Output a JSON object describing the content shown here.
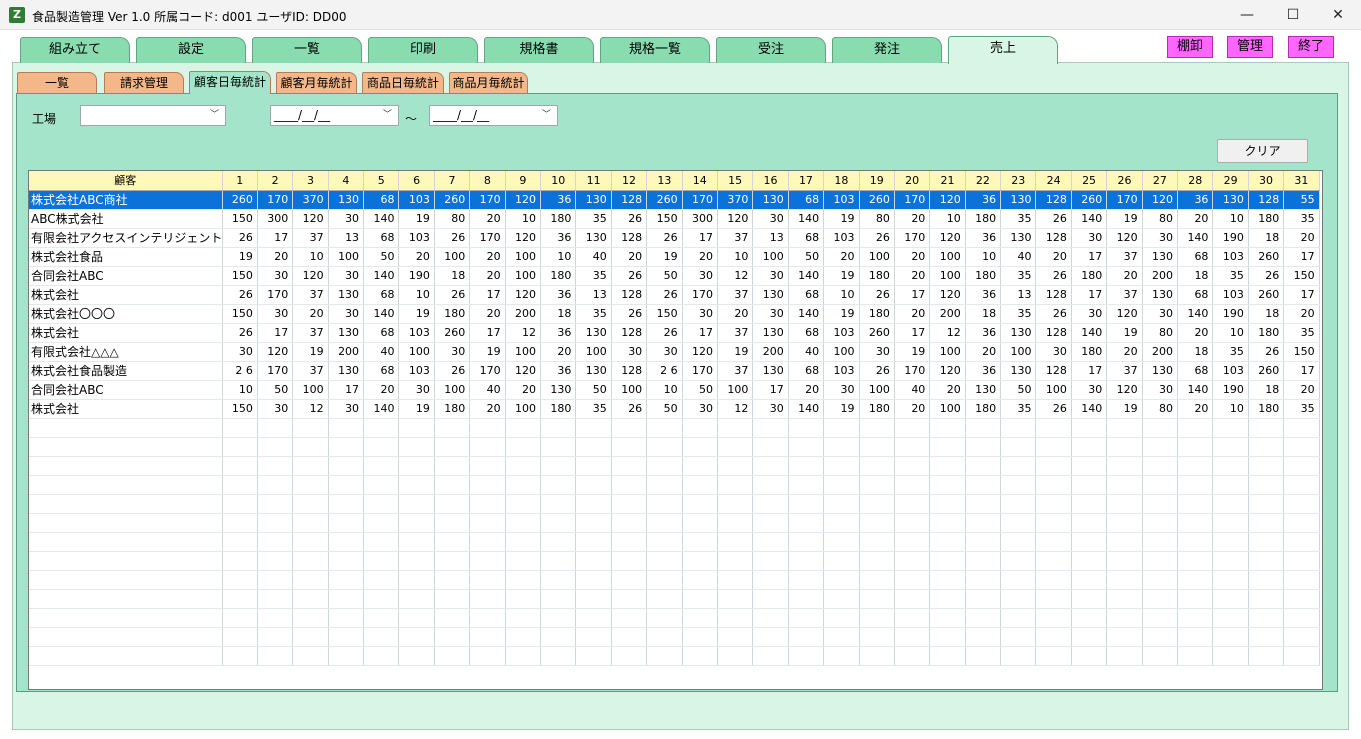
{
  "window": {
    "title": "食品製造管理 Ver 1.0  所属コード: d001    ユーザID: DD00",
    "icon_letter": "Z",
    "minimize": "—",
    "maximize": "☐",
    "close": "✕"
  },
  "main_tabs": [
    "組み立て",
    "設定",
    "一覧",
    "印刷",
    "規格書",
    "規格一覧",
    "受注",
    "発注",
    "売上"
  ],
  "action_buttons": [
    "棚卸",
    "管理",
    "終了"
  ],
  "sub_tabs": [
    "一覧",
    "請求管理",
    "顧客日毎統計",
    "顧客月毎統計",
    "商品日毎統計",
    "商品月毎統計"
  ],
  "filters": {
    "factory_label": "工場",
    "factory_value": "",
    "date_from": "____/__/__",
    "tilde": "～",
    "date_to": "____/__/__"
  },
  "clear_label": "クリア",
  "table": {
    "header_name": "顧客",
    "days": [
      "1",
      "2",
      "3",
      "4",
      "5",
      "6",
      "7",
      "8",
      "9",
      "10",
      "11",
      "12",
      "13",
      "14",
      "15",
      "16",
      "17",
      "18",
      "19",
      "20",
      "21",
      "22",
      "23",
      "24",
      "25",
      "26",
      "27",
      "28",
      "29",
      "30",
      "31"
    ],
    "rows": [
      {
        "name": "株式会社ABC商社",
        "v": [
          "260",
          "170",
          "370",
          "130",
          "68",
          "103",
          "260",
          "170",
          "120",
          "36",
          "130",
          "128",
          "260",
          "170",
          "370",
          "130",
          "68",
          "103",
          "260",
          "170",
          "120",
          "36",
          "130",
          "128",
          "260",
          "170",
          "120",
          "36",
          "130",
          "128",
          "55"
        ]
      },
      {
        "name": "ABC株式会社",
        "v": [
          "150",
          "300",
          "120",
          "30",
          "140",
          "19",
          "80",
          "20",
          "10",
          "180",
          "35",
          "26",
          "150",
          "300",
          "120",
          "30",
          "140",
          "19",
          "80",
          "20",
          "10",
          "180",
          "35",
          "26",
          "140",
          "19",
          "80",
          "20",
          "10",
          "180",
          "35"
        ]
      },
      {
        "name": "有限会社アクセスインテリジェント",
        "v": [
          "26",
          "17",
          "37",
          "13",
          "68",
          "103",
          "26",
          "170",
          "120",
          "36",
          "130",
          "128",
          "26",
          "17",
          "37",
          "13",
          "68",
          "103",
          "26",
          "170",
          "120",
          "36",
          "130",
          "128",
          "30",
          "120",
          "30",
          "140",
          "190",
          "18",
          "20"
        ]
      },
      {
        "name": "株式会社食品",
        "v": [
          "19",
          "20",
          "10",
          "100",
          "50",
          "20",
          "100",
          "20",
          "100",
          "10",
          "40",
          "20",
          "19",
          "20",
          "10",
          "100",
          "50",
          "20",
          "100",
          "20",
          "100",
          "10",
          "40",
          "20",
          "17",
          "37",
          "130",
          "68",
          "103",
          "260",
          "17"
        ]
      },
      {
        "name": "合同会社ABC",
        "v": [
          "150",
          "30",
          "120",
          "30",
          "140",
          "190",
          "18",
          "20",
          "100",
          "180",
          "35",
          "26",
          "50",
          "30",
          "12",
          "30",
          "140",
          "19",
          "180",
          "20",
          "100",
          "180",
          "35",
          "26",
          "180",
          "20",
          "200",
          "18",
          "35",
          "26",
          "150"
        ]
      },
      {
        "name": "株式会社",
        "v": [
          "26",
          "170",
          "37",
          "130",
          "68",
          "10",
          "26",
          "17",
          "120",
          "36",
          "13",
          "128",
          "26",
          "170",
          "37",
          "130",
          "68",
          "10",
          "26",
          "17",
          "120",
          "36",
          "13",
          "128",
          "17",
          "37",
          "130",
          "68",
          "103",
          "260",
          "17"
        ]
      },
      {
        "name": "株式会社〇〇〇",
        "v": [
          "150",
          "30",
          "20",
          "30",
          "140",
          "19",
          "180",
          "20",
          "200",
          "18",
          "35",
          "26",
          "150",
          "30",
          "20",
          "30",
          "140",
          "19",
          "180",
          "20",
          "200",
          "18",
          "35",
          "26",
          "30",
          "120",
          "30",
          "140",
          "190",
          "18",
          "20"
        ]
      },
      {
        "name": "株式会社",
        "v": [
          "26",
          "17",
          "37",
          "130",
          "68",
          "103",
          "260",
          "17",
          "12",
          "36",
          "130",
          "128",
          "26",
          "17",
          "37",
          "130",
          "68",
          "103",
          "260",
          "17",
          "12",
          "36",
          "130",
          "128",
          "140",
          "19",
          "80",
          "20",
          "10",
          "180",
          "35"
        ]
      },
      {
        "name": "有限式会社△△△",
        "v": [
          "30",
          "120",
          "19",
          "200",
          "40",
          "100",
          "30",
          "19",
          "100",
          "20",
          "100",
          "30",
          "30",
          "120",
          "19",
          "200",
          "40",
          "100",
          "30",
          "19",
          "100",
          "20",
          "100",
          "30",
          "180",
          "20",
          "200",
          "18",
          "35",
          "26",
          "150"
        ]
      },
      {
        "name": "株式会社食品製造",
        "v": [
          "2 6",
          "170",
          "37",
          "130",
          "68",
          "103",
          "26",
          "170",
          "120",
          "36",
          "130",
          "128",
          "2 6",
          "170",
          "37",
          "130",
          "68",
          "103",
          "26",
          "170",
          "120",
          "36",
          "130",
          "128",
          "17",
          "37",
          "130",
          "68",
          "103",
          "260",
          "17"
        ]
      },
      {
        "name": "合同会社ABC",
        "v": [
          "10",
          "50",
          "100",
          "17",
          "20",
          "30",
          "100",
          "40",
          "20",
          "130",
          "50",
          "100",
          "10",
          "50",
          "100",
          "17",
          "20",
          "30",
          "100",
          "40",
          "20",
          "130",
          "50",
          "100",
          "30",
          "120",
          "30",
          "140",
          "190",
          "18",
          "20"
        ]
      },
      {
        "name": "株式会社",
        "v": [
          "150",
          "30",
          "12",
          "30",
          "140",
          "19",
          "180",
          "20",
          "100",
          "180",
          "35",
          "26",
          "50",
          "30",
          "12",
          "30",
          "140",
          "19",
          "180",
          "20",
          "100",
          "180",
          "35",
          "26",
          "140",
          "19",
          "80",
          "20",
          "10",
          "180",
          "35"
        ]
      }
    ],
    "selected_row": 0
  },
  "colors": {
    "main_tab": "#88dcb0",
    "sub_tab": "#f4b78a",
    "panel": "#a4e4cb",
    "header": "#fff8b8",
    "selection": "#0a72d8",
    "pink": "#ff66ff"
  }
}
